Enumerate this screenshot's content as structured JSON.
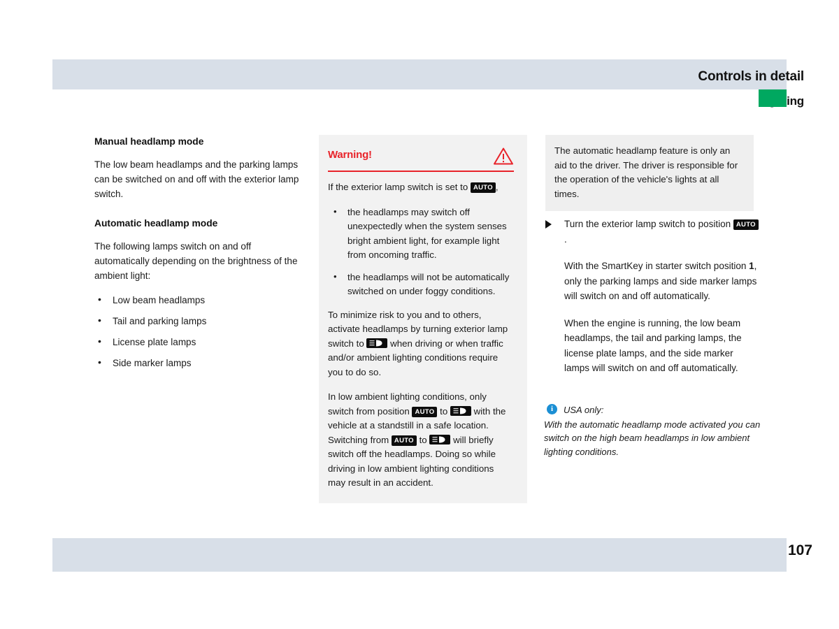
{
  "header": {
    "title": "Controls in detail",
    "subtitle": "Lighting",
    "tab_color": "#00a860",
    "bar_color": "#d8dfe8"
  },
  "left_column": {
    "section1": {
      "heading": "Manual headlamp mode",
      "paragraph": "The low beam headlamps and the parking lamps can be switched on and off with the exterior lamp switch."
    },
    "section2": {
      "heading": "Automatic headlamp mode",
      "paragraph": "The following lamps switch on and off automatically depending on the brightness of the ambient light:",
      "bullets": [
        "Low beam headlamps",
        "Tail and parking lamps",
        "License plate lamps",
        "Side marker lamps"
      ]
    }
  },
  "warning_box": {
    "title": "Warning!",
    "icon": "warning-triangle-icon",
    "accent_color": "#e8232a",
    "intro_before": "If the exterior lamp switch is set to",
    "intro_badge": "AUTO",
    "intro_after": ",",
    "bullets": [
      "the headlamps may switch off unexpectedly when the system senses bright ambient light, for example light from oncoming traffic.",
      "the headlamps will not be automatically switched on under foggy conditions."
    ],
    "para2_a": "To minimize risk to you and to others, activate headlamps by turning exterior lamp switch to",
    "para2_badge": "low-beam-headlamp-icon",
    "para2_b": "when driving or when traffic and/or ambient lighting conditions require you to do so.",
    "para3_a": "In low ambient lighting conditions, only switch from position",
    "para3_badge1": "AUTO",
    "para3_b": "to",
    "para3_badge2": "low-beam-headlamp-icon",
    "para3_c": "with the vehicle at a standstill in a safe location. Switching from",
    "para3_badge3": "AUTO",
    "para3_d": "to",
    "para3_badge4": "low-beam-headlamp-icon",
    "para3_e": "will briefly switch off the headlamps. Doing so while driving in low ambient lighting conditions may result in an accident."
  },
  "right_column": {
    "note": "The automatic headlamp feature is only an aid to the driver. The driver is responsible for the operation of the vehicle's lights at all times.",
    "step": {
      "arrow": "step-arrow-icon",
      "text_before": "Turn the exterior lamp switch to position",
      "badge": "AUTO",
      "text_after": "."
    },
    "paragraph_smartkey_a": "With the SmartKey in starter switch position",
    "paragraph_smartkey_bold": "1",
    "paragraph_smartkey_b": ", only the parking lamps and side marker lamps will switch on and off automatically.",
    "paragraph_engine": "When the engine is running, the low beam headlamps, the tail and parking lamps, the license plate lamps, and the side marker lamps will switch on and off automatically.",
    "usa": {
      "icon": "info-icon",
      "icon_glyph": "i",
      "icon_color": "#1b8fd4",
      "heading": "USA only:",
      "text": "With the automatic headlamp mode activated you can switch on the high beam headlamps in low ambient lighting conditions."
    }
  },
  "footer": {
    "page_number": "107",
    "bar_color": "#d8dfe8"
  }
}
